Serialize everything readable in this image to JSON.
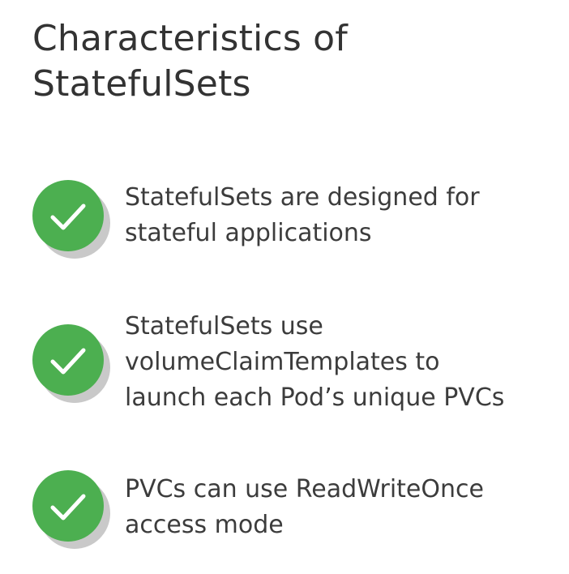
{
  "slide": {
    "title_lines": [
      "Characteristics of",
      "StatefulSets"
    ],
    "items": [
      {
        "icon": "check-circle-icon",
        "text": "StatefulSets are designed for\nstateful applications"
      },
      {
        "icon": "check-circle-icon",
        "text": "StatefulSets use\nvolumeClaimTemplates to\nlaunch each Pod’s unique PVCs"
      },
      {
        "icon": "check-circle-icon",
        "text": "PVCs can use ReadWriteOnce\naccess mode"
      }
    ]
  },
  "colors": {
    "check_green": "#4caf50",
    "text": "#3c3c3c",
    "shadow": "#c9c9c9"
  }
}
